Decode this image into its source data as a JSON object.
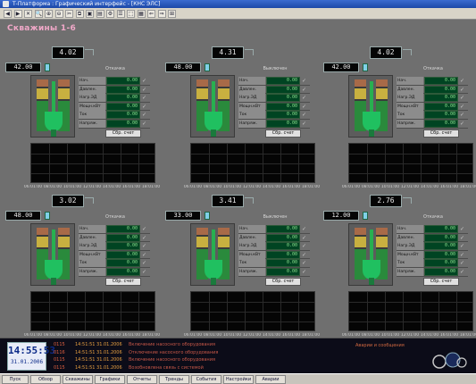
{
  "window": {
    "title": "Т-Платформа : Графический интерфейс - [КНС ЭЛС]"
  },
  "screen_title": "Скважины 1-6",
  "pumps": [
    {
      "top_value": "4.02",
      "side_value": "42.00",
      "status_label": "Откачка"
    },
    {
      "top_value": "4.31",
      "side_value": "48.00",
      "status_label": "Выключен"
    },
    {
      "top_value": "4.02",
      "side_value": "42.00",
      "status_label": "Откачка"
    },
    {
      "top_value": "3.02",
      "side_value": "48.00",
      "status_label": "Откачка"
    },
    {
      "top_value": "3.41",
      "side_value": "33.00",
      "status_label": "Выключен"
    },
    {
      "top_value": "2.76",
      "side_value": "12.00",
      "status_label": "Откачка"
    }
  ],
  "param_labels": [
    "Нач.",
    "Давлен.",
    "Нагр.ЭД",
    "Мощн.кВт",
    "Ток",
    "Напряж."
  ],
  "param_values": [
    "0.00",
    "0.00",
    "0.00",
    "0.00",
    "0.00",
    "0.00"
  ],
  "reset_label": "Сбр. счет",
  "trend_ticks": [
    "06:01:00",
    "08:01:00",
    "10:01:00",
    "12:01:00",
    "14:01:00",
    "16:01:00",
    "18:01:00"
  ],
  "clock": {
    "time": "14:55:53",
    "date": "31.01.2006"
  },
  "events": [
    {
      "code": "0115",
      "time": "14:51:51 31.01.2006",
      "msg": "Включение насосного оборудования"
    },
    {
      "code": "0116",
      "time": "14:51:51 31.01.2006",
      "msg": "Отключение насосного оборудования"
    },
    {
      "code": "0115",
      "time": "14:51:51 31.01.2006",
      "msg": "Включение насосного оборудования"
    },
    {
      "code": "0115",
      "time": "14:51:51 31.01.2006",
      "msg": "Возобновлена связь с системой"
    }
  ],
  "alarm_text": "Аварии и сообщения",
  "taskbar": [
    "Пуск",
    "Обзор",
    "Скважины",
    "Графики",
    "Отчеты",
    "Тренды",
    "События",
    "Настройки",
    "Аварии"
  ],
  "colors": {
    "background": "#6f6f6f",
    "panel_dark": "#050505",
    "pump_green": "#20c060",
    "title_pink": "#f0a8c8",
    "event_orange": "#d06840"
  },
  "icons": {
    "alarm": "alarm-bell-icon",
    "check": "check-icon"
  }
}
